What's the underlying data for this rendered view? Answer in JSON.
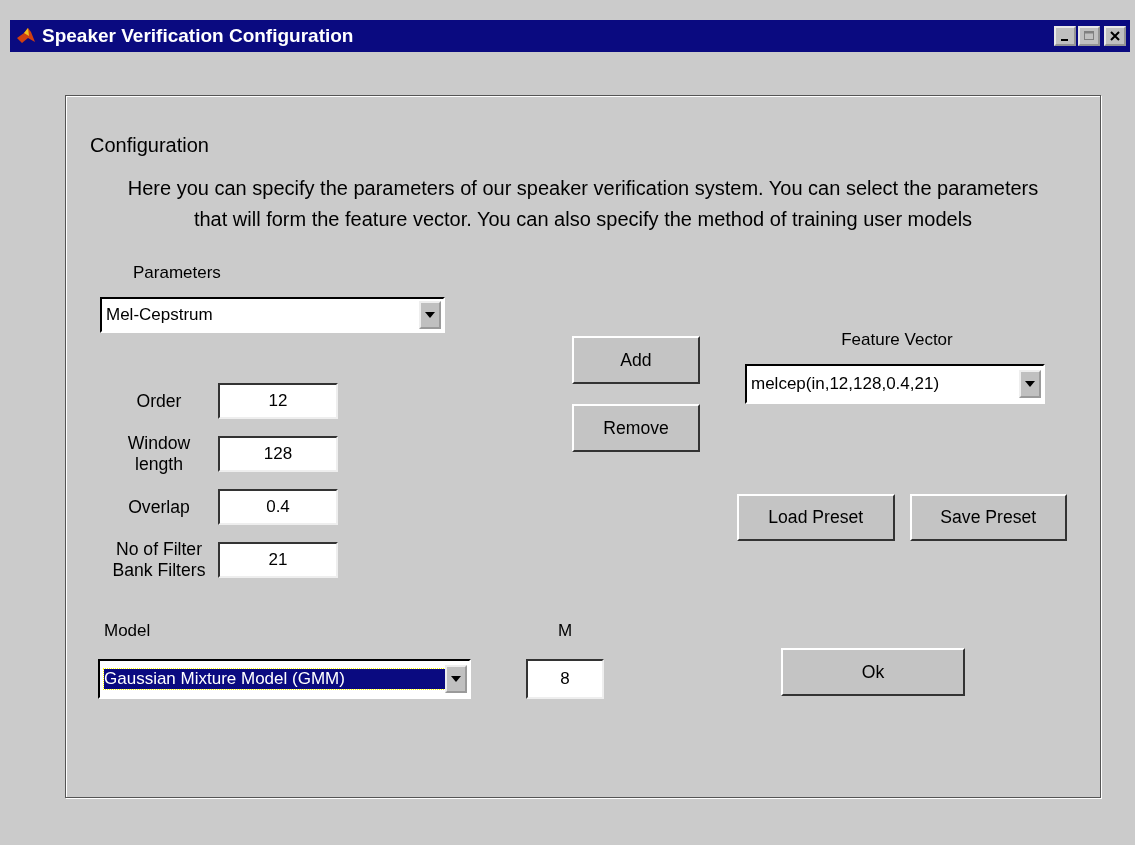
{
  "window": {
    "title": "Speaker Verification Configuration"
  },
  "panel": {
    "heading": "Configuration",
    "description": "Here you can specify the parameters of our speaker verification system. You can select the parameters that will form the feature vector. You can also specify the method of training user models"
  },
  "parameters": {
    "label": "Parameters",
    "value": "Mel-Cepstrum",
    "selected": false
  },
  "fields": [
    {
      "label": "Order",
      "value": "12"
    },
    {
      "label": "Window length",
      "value": "128"
    },
    {
      "label": "Overlap",
      "value": "0.4"
    },
    {
      "label": "No of Filter Bank Filters",
      "value": "21"
    }
  ],
  "list_buttons": [
    "Add",
    "Remove"
  ],
  "feature_vector": {
    "label": "Feature Vector",
    "value": "melcep(in,12,128,0.4,21)",
    "selected": false
  },
  "preset_buttons": [
    "Load Preset",
    "Save Preset"
  ],
  "model": {
    "label": "Model",
    "value": "Gaussian Mixture Model (GMM)",
    "selected": true
  },
  "m": {
    "label": "M",
    "value": "8"
  },
  "ok_button": "Ok"
}
